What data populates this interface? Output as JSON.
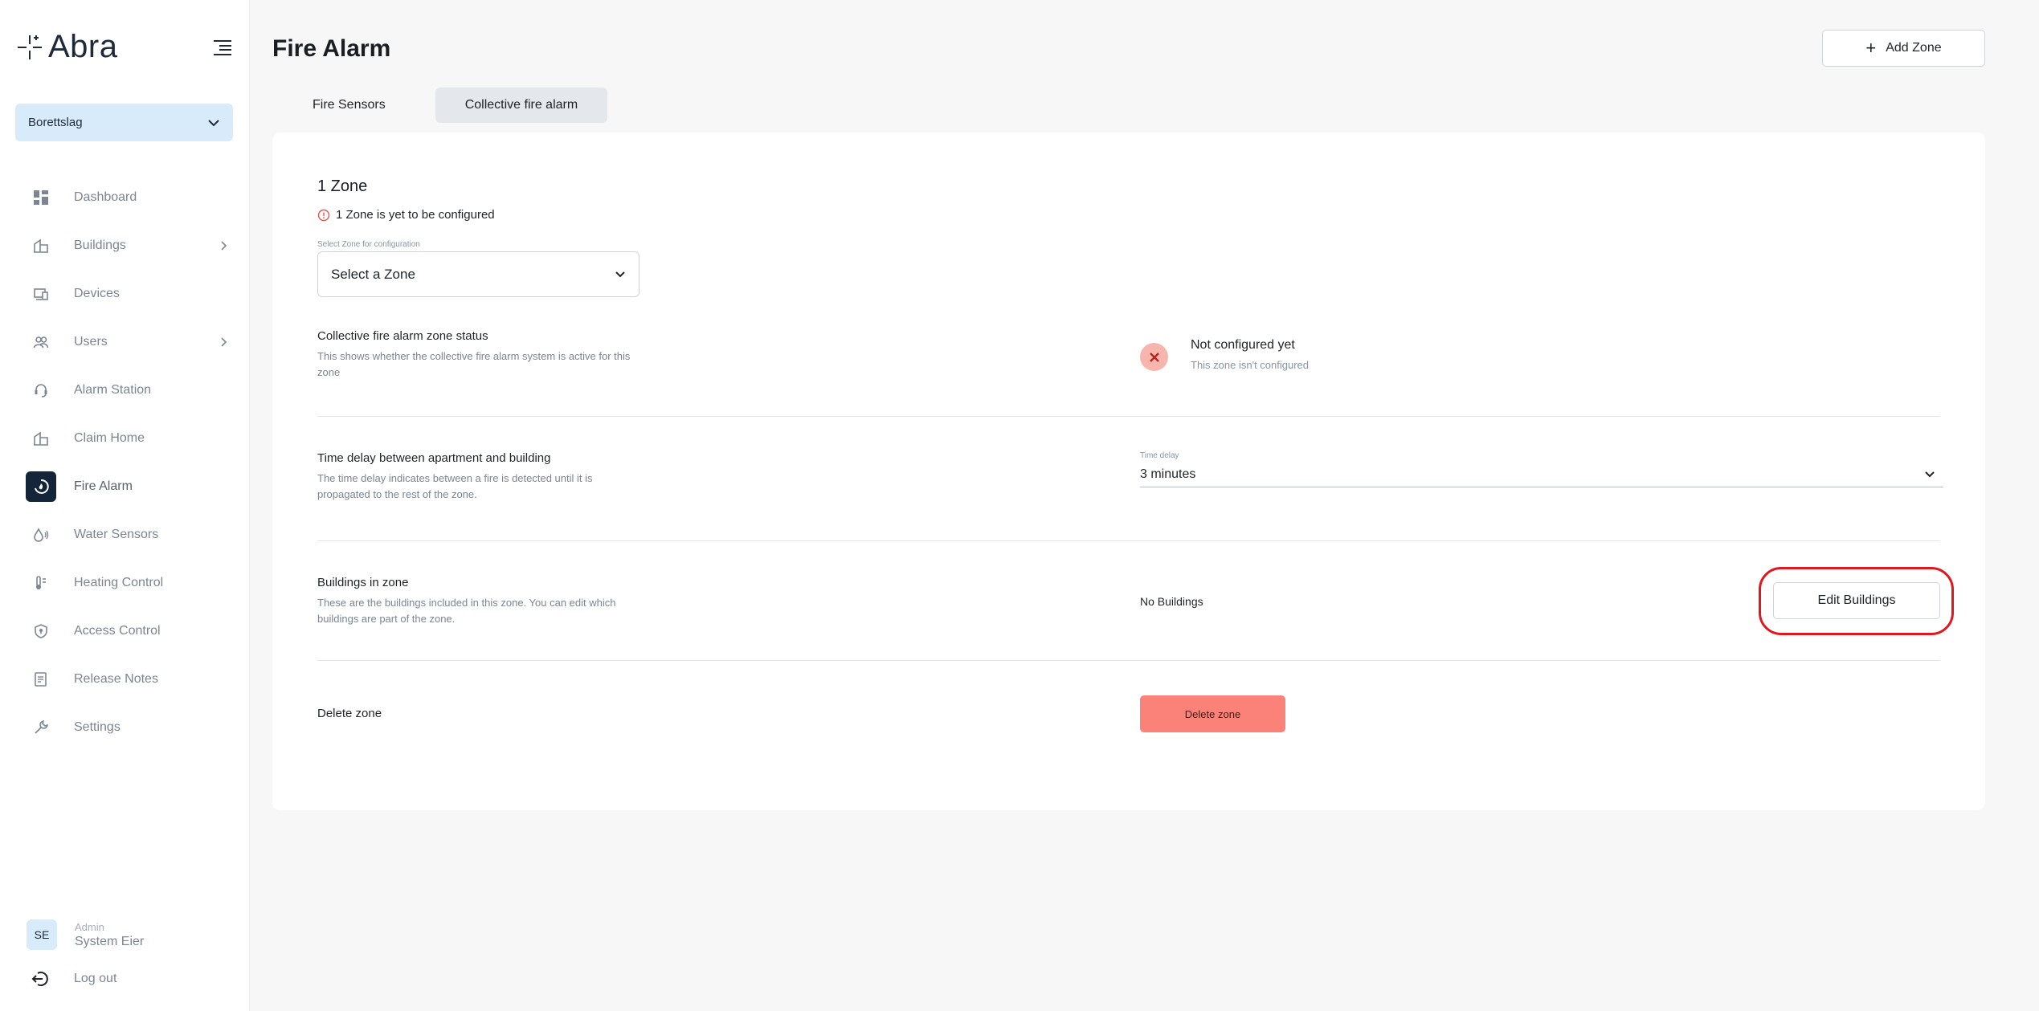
{
  "app": {
    "name": "Abra"
  },
  "sidebar": {
    "org_select": {
      "value": "Borettslag"
    },
    "items": [
      {
        "label": "Dashboard",
        "icon": "dashboard-icon",
        "has_chevron": false
      },
      {
        "label": "Buildings",
        "icon": "buildings-icon",
        "has_chevron": true
      },
      {
        "label": "Devices",
        "icon": "devices-icon",
        "has_chevron": false
      },
      {
        "label": "Users",
        "icon": "users-icon",
        "has_chevron": true
      },
      {
        "label": "Alarm Station",
        "icon": "alarm-station-icon",
        "has_chevron": false
      },
      {
        "label": "Claim Home",
        "icon": "claim-home-icon",
        "has_chevron": false
      },
      {
        "label": "Fire Alarm",
        "icon": "fire-alarm-icon",
        "has_chevron": false,
        "active": true
      },
      {
        "label": "Water Sensors",
        "icon": "water-sensors-icon",
        "has_chevron": false
      },
      {
        "label": "Heating Control",
        "icon": "heating-control-icon",
        "has_chevron": false
      },
      {
        "label": "Access Control",
        "icon": "access-control-icon",
        "has_chevron": false
      },
      {
        "label": "Release Notes",
        "icon": "release-notes-icon",
        "has_chevron": false
      },
      {
        "label": "Settings",
        "icon": "settings-icon",
        "has_chevron": false
      }
    ],
    "user": {
      "initials": "SE",
      "role": "Admin",
      "name": "System Eier"
    },
    "logout_label": "Log out"
  },
  "header": {
    "title": "Fire Alarm",
    "add_zone_label": "Add Zone"
  },
  "tabs": [
    {
      "label": "Fire Sensors",
      "active": false
    },
    {
      "label": "Collective fire alarm",
      "active": true
    }
  ],
  "zone": {
    "title": "1 Zone",
    "warning": "1 Zone is yet to be configured",
    "select_label": "Select Zone for configuration",
    "select_value": "Select a Zone"
  },
  "status_row": {
    "title": "Collective fire alarm zone status",
    "description": "This shows whether the collective fire alarm system is active for this zone",
    "status_title": "Not configured yet",
    "status_sub": "This zone isn't configured"
  },
  "delay_row": {
    "title": "Time delay between apartment and building",
    "description": "The time delay indicates between a fire is detected until it is propagated to the rest of the zone.",
    "select_label": "Time delay",
    "select_value": "3 minutes"
  },
  "buildings_row": {
    "title": "Buildings in zone",
    "description": "These are the buildings included in this zone. You can edit which buildings are part of the zone.",
    "value": "No Buildings",
    "button_label": "Edit Buildings"
  },
  "delete_row": {
    "title": "Delete zone",
    "button_label": "Delete zone"
  },
  "colors": {
    "accent": "#14253a",
    "org_select_bg": "#d7ebfb",
    "danger": "#fb8278",
    "status_error_bg": "#f7b5ae",
    "highlight": "#e0171f"
  }
}
